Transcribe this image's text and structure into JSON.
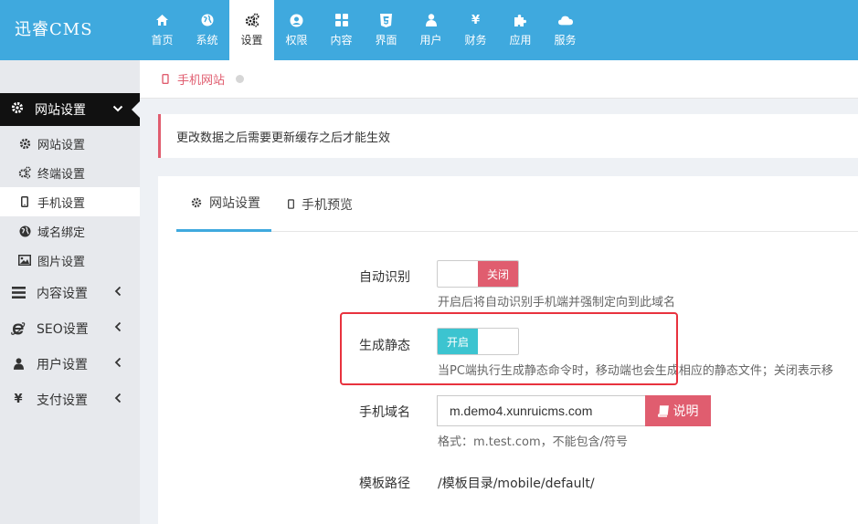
{
  "brand": {
    "logo": "迅睿CMS"
  },
  "nav": [
    {
      "label": "首页",
      "icon": "home-icon"
    },
    {
      "label": "系统",
      "icon": "globe-icon"
    },
    {
      "label": "设置",
      "icon": "cogs-icon",
      "active": true
    },
    {
      "label": "权限",
      "icon": "user-circle-icon"
    },
    {
      "label": "内容",
      "icon": "th-large-icon"
    },
    {
      "label": "界面",
      "icon": "html5-icon"
    },
    {
      "label": "用户",
      "icon": "user-icon"
    },
    {
      "label": "财务",
      "icon": "yen-icon"
    },
    {
      "label": "应用",
      "icon": "puzzle-icon"
    },
    {
      "label": "服务",
      "icon": "cloud-icon"
    }
  ],
  "sidebar": {
    "section": "网站设置",
    "items": [
      {
        "label": "网站设置",
        "icon": "gear-icon"
      },
      {
        "label": "终端设置",
        "icon": "cogs-icon"
      },
      {
        "label": "手机设置",
        "icon": "mobile-icon",
        "active": true
      },
      {
        "label": "域名绑定",
        "icon": "globe-icon"
      },
      {
        "label": "图片设置",
        "icon": "image-icon"
      }
    ],
    "groups": [
      {
        "label": "内容设置",
        "icon": "bars-icon"
      },
      {
        "label": "SEO设置",
        "icon": "ie-icon"
      },
      {
        "label": "用户设置",
        "icon": "user-icon"
      },
      {
        "label": "支付设置",
        "icon": "yen-icon"
      }
    ]
  },
  "breadcrumb": {
    "label": "手机网站"
  },
  "notice": "更改数据之后需要更新缓存之后才能生效",
  "tabs": [
    {
      "label": "网站设置",
      "icon": "gear-icon",
      "active": true
    },
    {
      "label": "手机预览",
      "icon": "mobile-icon"
    }
  ],
  "form": {
    "auto_detect": {
      "label": "自动识别",
      "switch_text": "关闭",
      "help": "开启后将自动识别手机端并强制定向到此域名"
    },
    "static_gen": {
      "label": "生成静态",
      "switch_text": "开启",
      "help": "当PC端执行生成静态命令时，移动端也会生成相应的静态文件；关闭表示移"
    },
    "domain": {
      "label": "手机域名",
      "value": "m.demo4.xunruicms.com",
      "button": "说明",
      "help": "格式：m.test.com，不能包含/符号"
    },
    "template": {
      "label": "模板路径",
      "value": "/模板目录/mobile/default/"
    }
  },
  "colors": {
    "topbar": "#3fa9de",
    "accent": "#e05d6f",
    "on": "#3cc4d0",
    "highlight": "#e8323e"
  }
}
